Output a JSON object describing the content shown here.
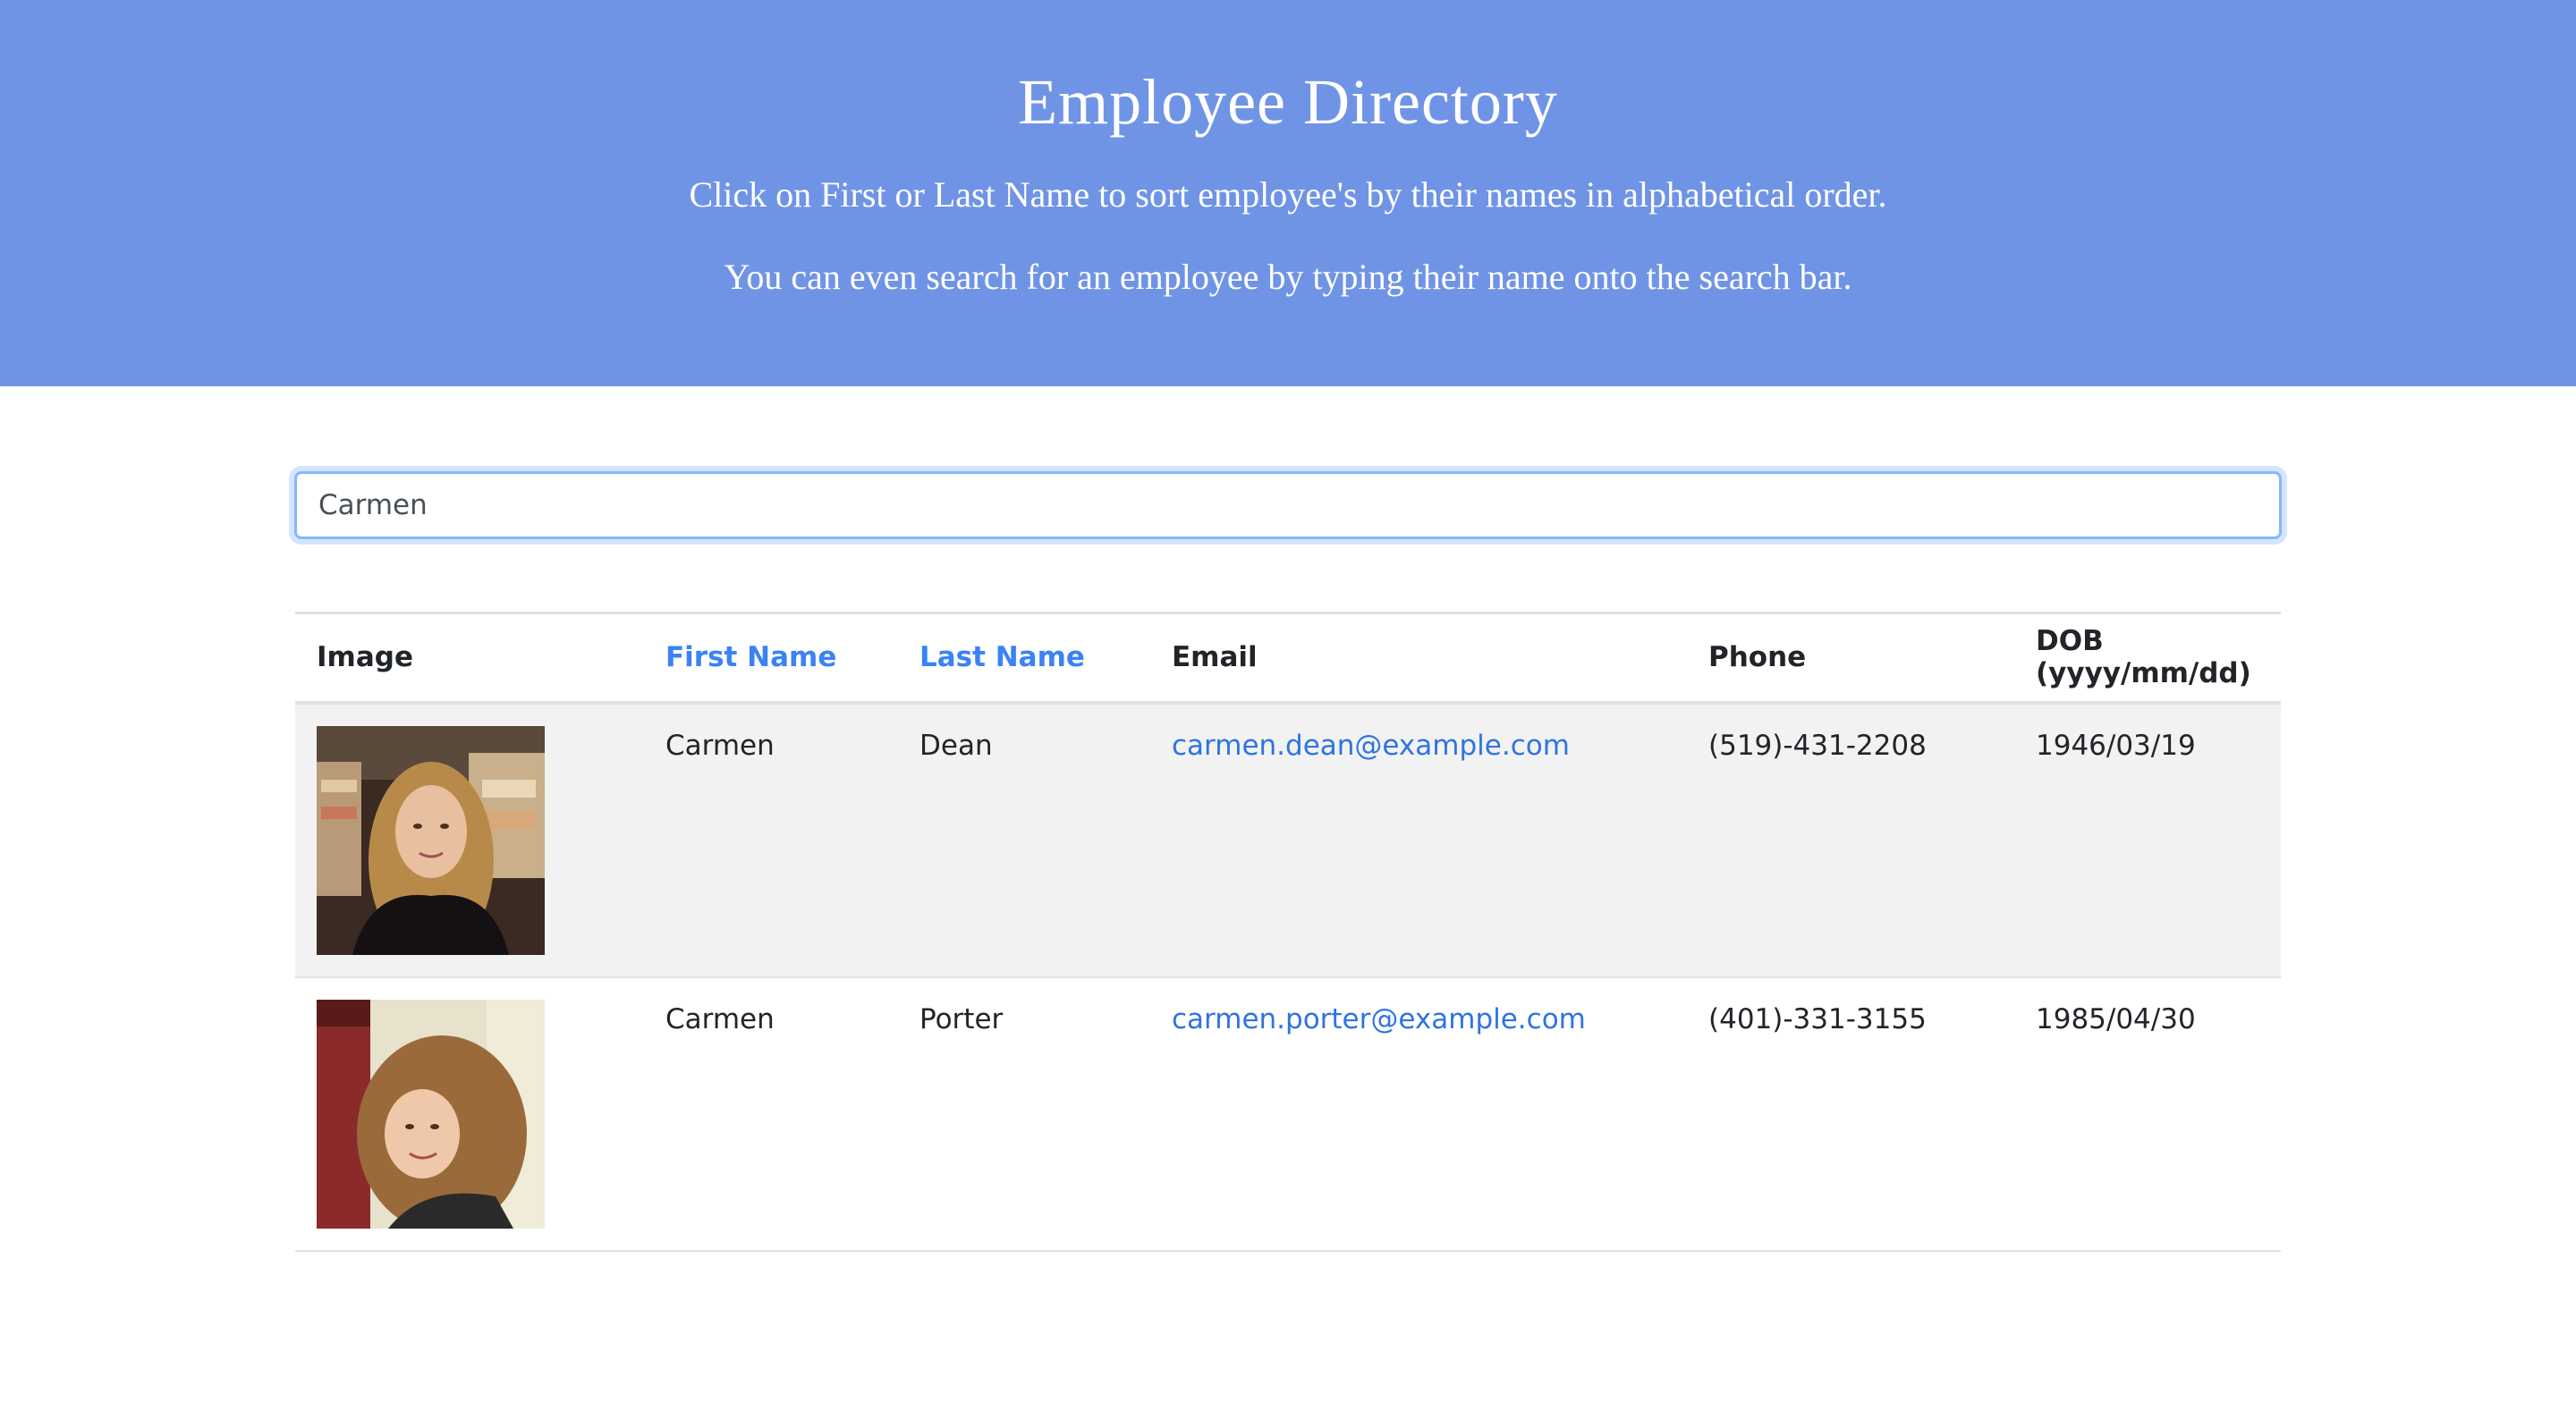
{
  "header": {
    "title": "Employee Directory",
    "instruction_sort": "Click on First or Last Name to sort employee's by their names in alphabetical order.",
    "instruction_search": "You can even search for an employee by typing their name onto the search bar."
  },
  "search": {
    "value": "Carmen"
  },
  "table": {
    "headers": {
      "image": "Image",
      "first_name": "First Name",
      "last_name": "Last Name",
      "email": "Email",
      "phone": "Phone",
      "dob": "DOB (yyyy/mm/dd)"
    },
    "rows": [
      {
        "first_name": "Carmen",
        "last_name": "Dean",
        "email": "carmen.dean@example.com",
        "phone": "(519)-431-2208",
        "dob": "1946/03/19"
      },
      {
        "first_name": "Carmen",
        "last_name": "Porter",
        "email": "carmen.porter@example.com",
        "phone": "(401)-331-3155",
        "dob": "1985/04/30"
      }
    ]
  },
  "colors": {
    "header_bg": "#7094e5",
    "sortable_header": "#3b82f6",
    "link": "#2f74e0",
    "stripe": "#f2f2f2"
  }
}
